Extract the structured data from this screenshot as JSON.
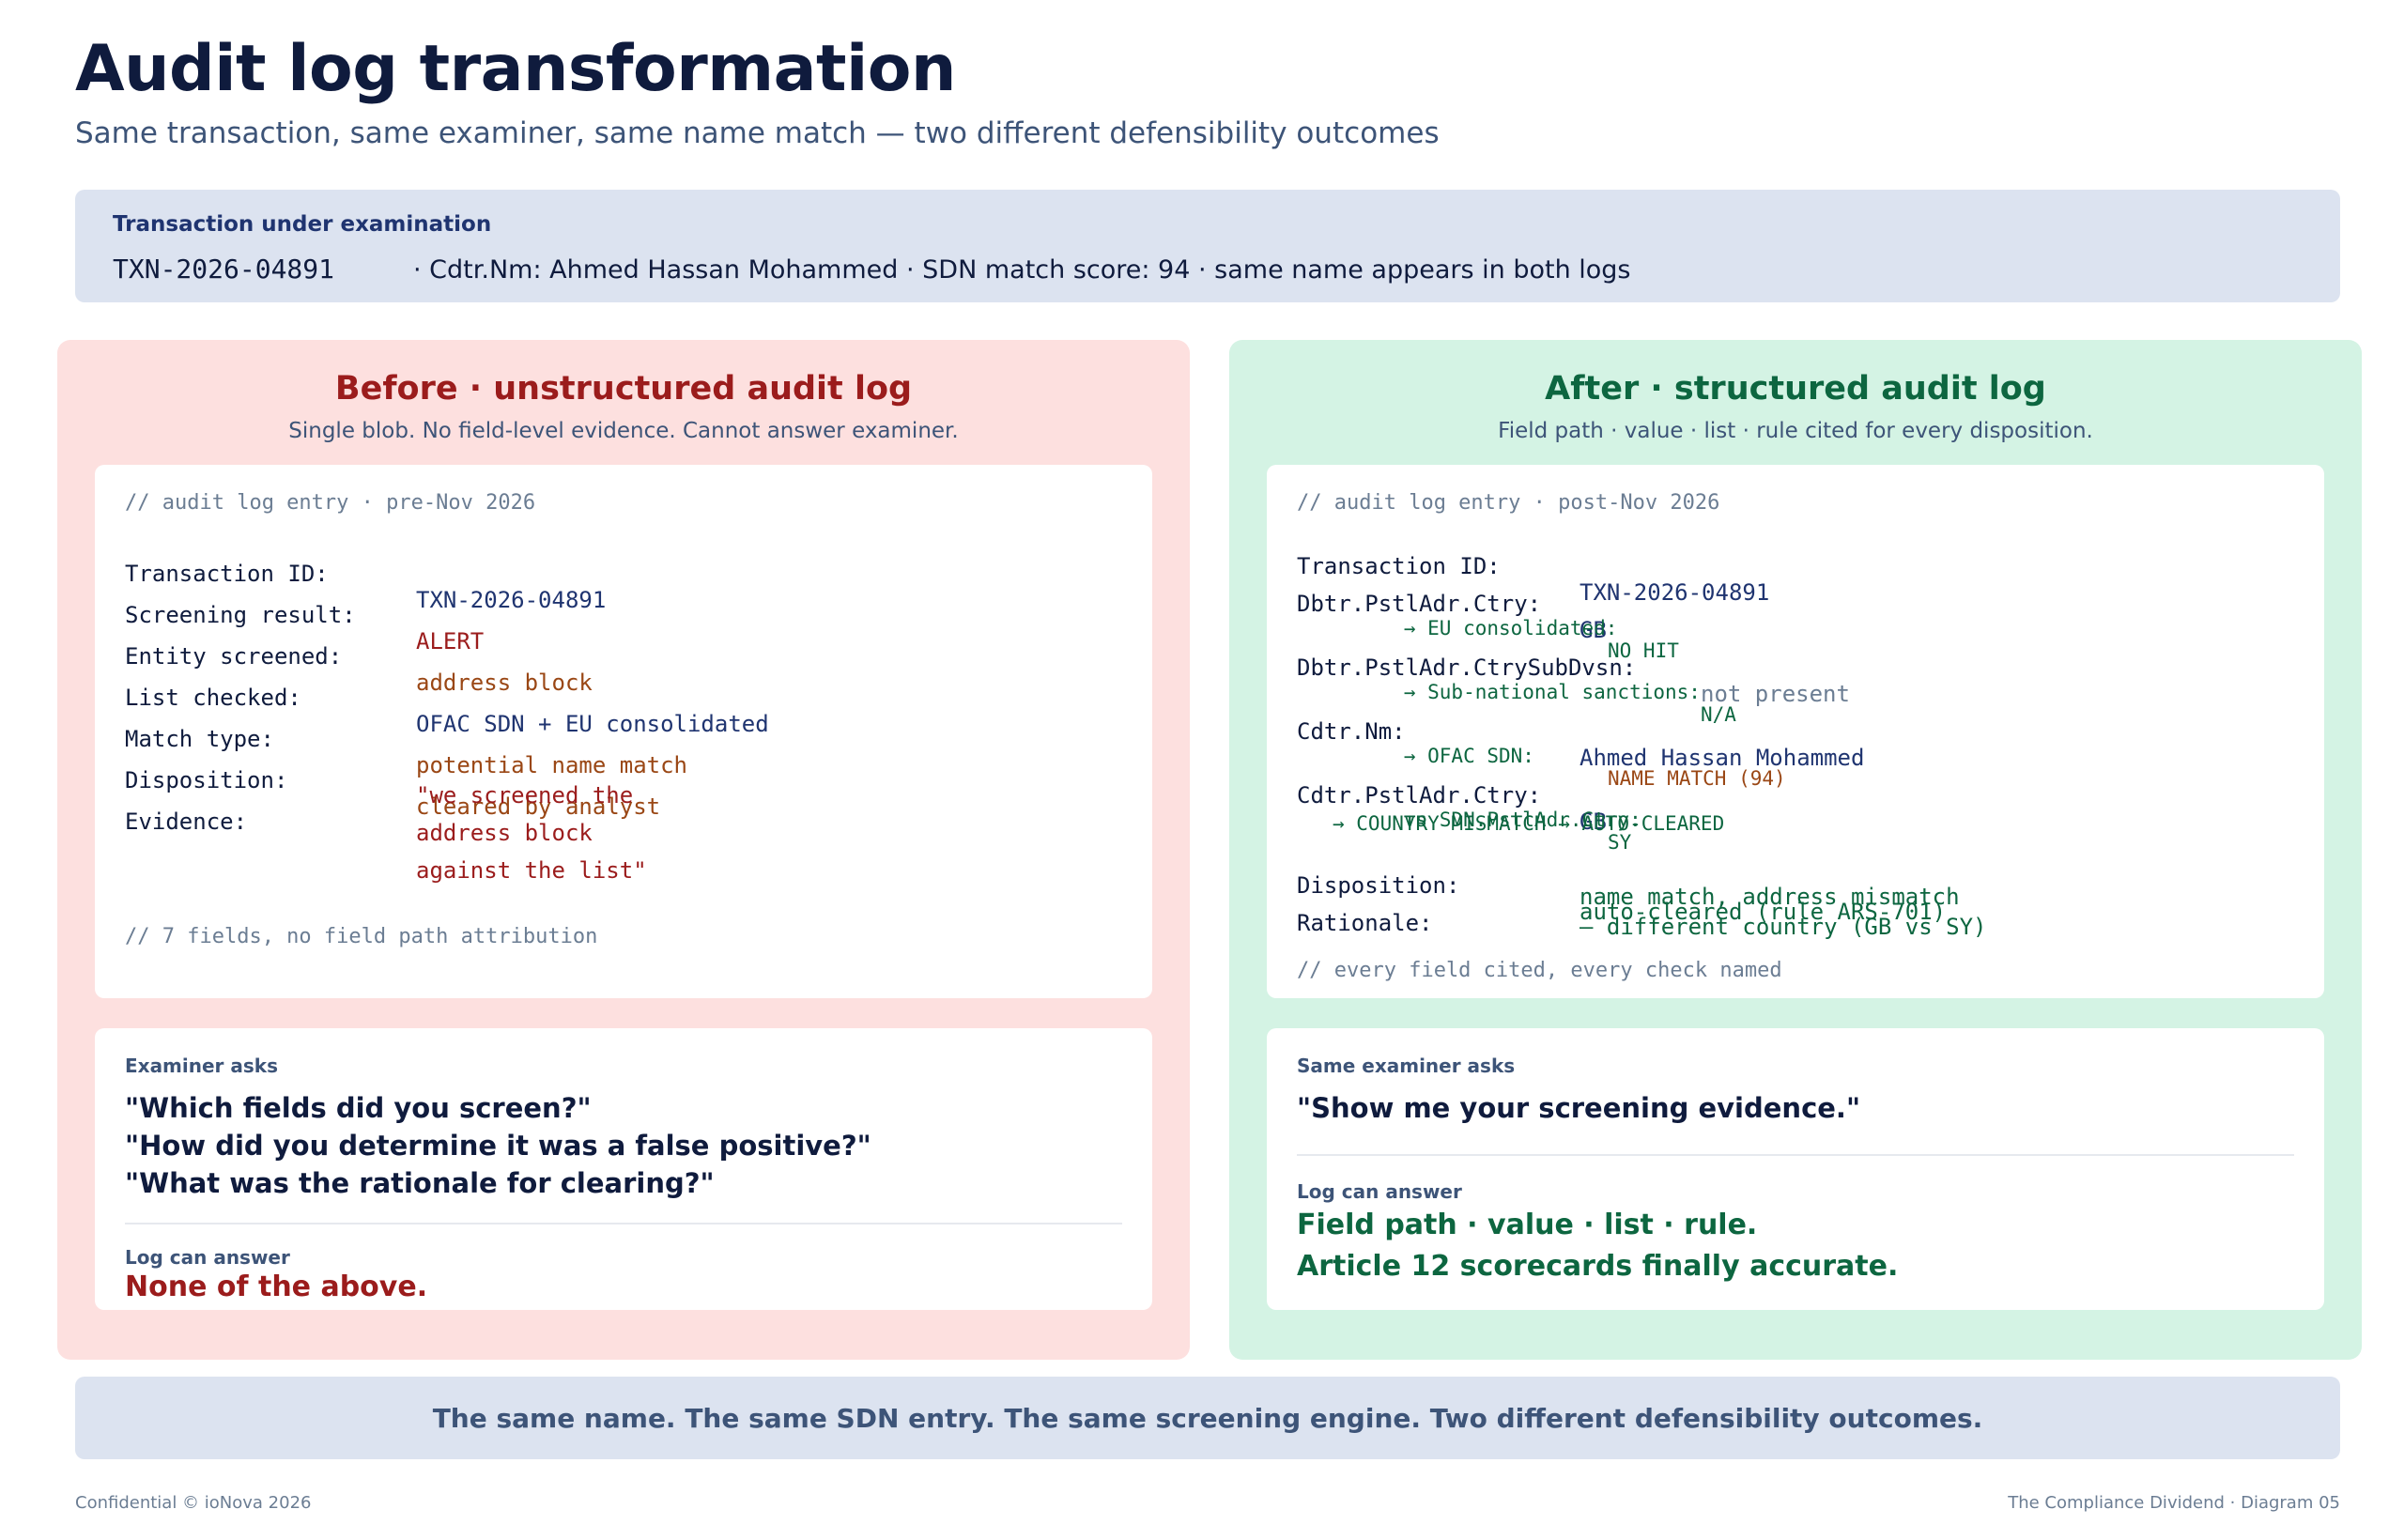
{
  "header": {
    "title": "Audit log transformation",
    "subtitle": "Same transaction, same examiner, same name match — two different defensibility outcomes"
  },
  "transaction": {
    "label": "Transaction under examination",
    "id": "TXN-2026-04891",
    "detail": "· Cdtr.Nm: Ahmed Hassan Mohammed · SDN match score: 94 · same name appears in both logs"
  },
  "before": {
    "title": "Before · unstructured audit log",
    "subtitle": "Single blob. No field-level evidence. Cannot answer examiner.",
    "log_comment_top": "// audit log entry · pre-Nov 2026",
    "fields": [
      {
        "key": "Transaction ID:",
        "value": "TXN-2026-04891"
      },
      {
        "key": "Screening result:",
        "value": "ALERT"
      },
      {
        "key": "Entity screened:",
        "value": "address block"
      },
      {
        "key": "List checked:",
        "value": "OFAC SDN + EU consolidated"
      },
      {
        "key": "Match type:",
        "value": "potential name match"
      },
      {
        "key": "Disposition:",
        "value": "cleared by analyst"
      },
      {
        "key": "Evidence:",
        "value_lines": [
          "\"we screened the",
          "address block",
          "against the list\""
        ]
      }
    ],
    "log_comment_bottom": "// 7 fields, no field path attribution",
    "ask_label": "Examiner asks",
    "questions": [
      "\"Which fields did you screen?\"",
      "\"How did you determine it was a false positive?\"",
      "\"What was the rationale for clearing?\""
    ],
    "answer_label": "Log can answer",
    "answer": "None of the above."
  },
  "after": {
    "title": "After · structured audit log",
    "subtitle": "Field path · value · list · rule cited for every disposition.",
    "log_comment_top": "// audit log entry · post-Nov 2026",
    "txn_key": "Transaction ID:",
    "txn_value": "TXN-2026-04891",
    "dbtr_ctry_key": "Dbtr.PstlAdr.Ctry:",
    "dbtr_ctry_value": "GB",
    "dbtr_ctry_check": "→ EU consolidated:",
    "dbtr_ctry_result": "NO HIT",
    "subdvsn_key": "Dbtr.PstlAdr.CtrySubDvsn:",
    "subdvsn_value": "not present",
    "subdvsn_check": "→ Sub-national sanctions:",
    "subdvsn_result": "N/A",
    "cdtr_nm_key": "Cdtr.Nm:",
    "cdtr_nm_value": "Ahmed Hassan Mohammed",
    "cdtr_nm_check": "→ OFAC SDN:",
    "cdtr_nm_result": "NAME MATCH (94)",
    "cdtr_ctry_key": "Cdtr.PstlAdr.Ctry:",
    "cdtr_ctry_value": "GB",
    "sdn_ctry_check": "vs SDN.PstlAdr.Ctry:",
    "sdn_ctry_value": "SY",
    "mismatch_line": "→ COUNTRY MISMATCH → AUTO-CLEARED",
    "disposition_key": "Disposition:",
    "disposition_value": "auto-cleared (rule ARS-701)",
    "rationale_key": "Rationale:",
    "rationale_lines": [
      "name match, address mismatch",
      "— different country (GB vs SY)"
    ],
    "log_comment_bottom": "// every field cited, every check named",
    "ask_label": "Same examiner asks",
    "question": "\"Show me your screening evidence.\"",
    "answer_label": "Log can answer",
    "answer_lines": [
      "Field path · value · list · rule.",
      "Article 12 scorecards finally accurate."
    ]
  },
  "banner": "The same name. The same SDN entry. The same screening engine. Two different defensibility outcomes.",
  "footer": {
    "left": "Confidential © ioNova 2026",
    "right": "The Compliance Dividend · Diagram 05"
  },
  "colors": {
    "before_panel": "#fde0df",
    "after_panel": "#d4f3e4",
    "before_accent": "#9b1c1c",
    "after_accent": "#0d6640",
    "info_box": "#dce3f0",
    "title": "#0f1b3d"
  }
}
